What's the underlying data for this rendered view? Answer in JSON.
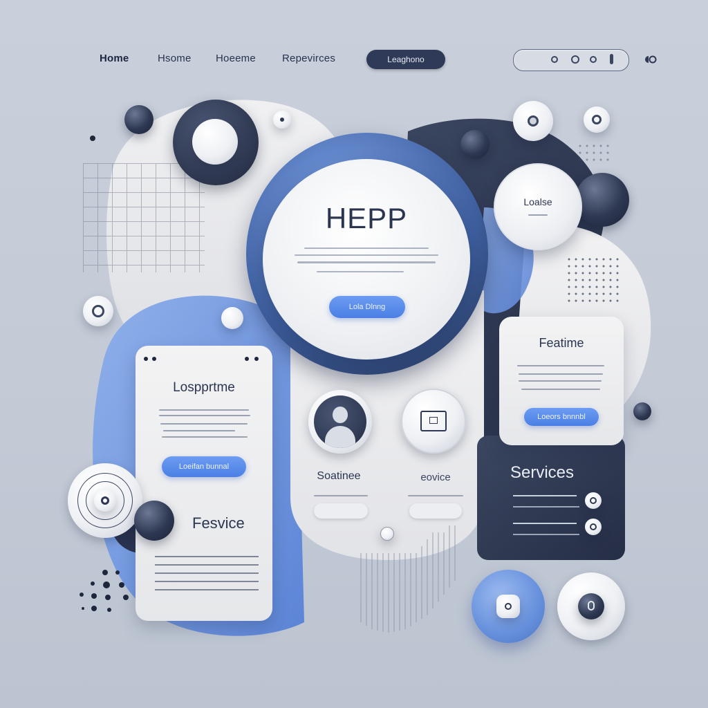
{
  "nav": {
    "items": [
      "Home",
      "Hsome",
      "Hoeeme",
      "Repevirces"
    ],
    "cta_label": "Leaghono"
  },
  "hero": {
    "title": "HEPP",
    "button_label": "Lola Dlnng"
  },
  "left_card": {
    "title": "Lospprtme",
    "button_label": "Loeifan bunnal",
    "section_title": "Fesvice"
  },
  "center": {
    "profile_label": "Soatinee",
    "device_label": "eovice"
  },
  "top_right_badge": {
    "title": "Loalse"
  },
  "right_card": {
    "title": "Featime",
    "button_label": "Loeors bnnnbl"
  },
  "services_panel": {
    "title": "Services"
  },
  "colors": {
    "accent_blue": "#4a7fe4",
    "navy": "#2e3852",
    "background": "#c6cdd8"
  },
  "icons": [
    "user-avatar-icon",
    "device-icon",
    "target-icon",
    "toggle-icon"
  ]
}
